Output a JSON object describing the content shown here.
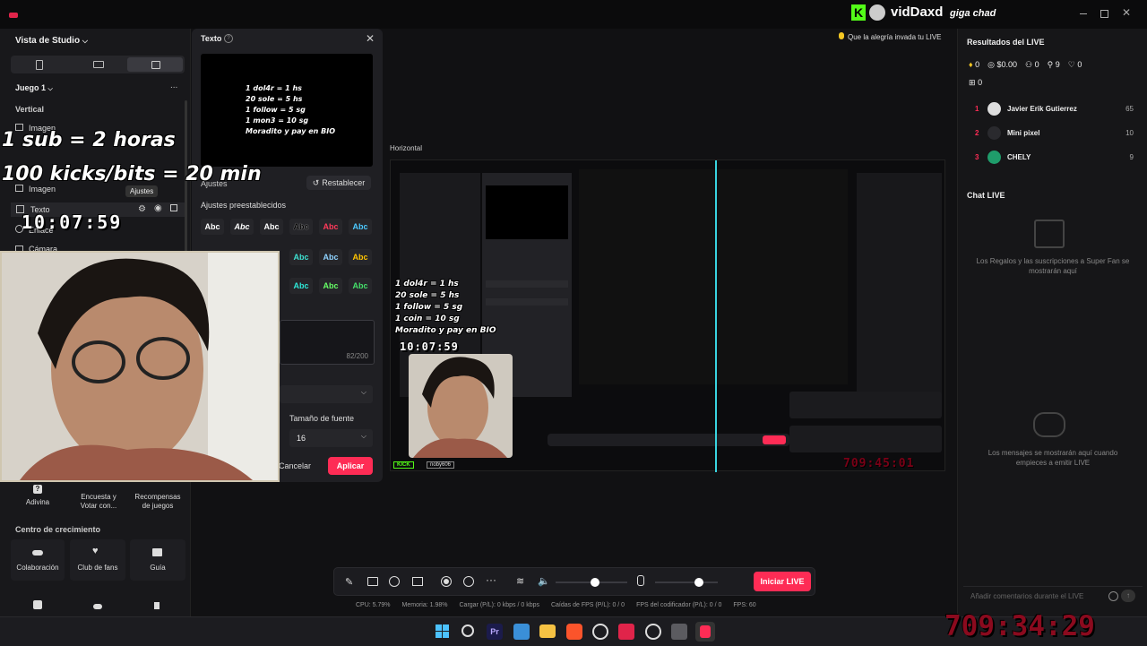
{
  "topbar": {
    "streamer_name": "vidDaxd",
    "nickname": "giga chad"
  },
  "left_panel": {
    "studio_view_label": "Vista de Studio",
    "game_label": "Juego 1",
    "more_label": "...",
    "vertical_label": "Vertical",
    "sources": [
      "Imagen",
      "Imagen",
      "Texto",
      "Enlace",
      "Cámara"
    ],
    "settings_tooltip": "Ajustes",
    "tools": [
      "Adivina",
      "Encuesta y Votar con...",
      "Recompensas de juegos"
    ],
    "growth_center_label": "Centro de crecimiento",
    "growth_items": [
      "Colaboración",
      "Club de fans",
      "Guía"
    ]
  },
  "overlay": {
    "sub_text": "1 sub = 2 horas",
    "kicks_text": "100 kicks/bits = 20 min",
    "clock_small": "10:07:59",
    "countdown": "709:34:29"
  },
  "dialog": {
    "title": "Texto",
    "preview_lines": [
      "1 dol4r = 1 hs",
      "20 sole = 5 hs",
      "1 follow = 5 sg",
      "1 mon3 = 10 sg",
      "Moradito y pay en BIO"
    ],
    "adjust_label": "Ajustes",
    "reset_label": "Restablecer",
    "presets_label": "Ajustes preestablecidos",
    "preset_text": "Abc",
    "char_count": "82/200",
    "font_size_label": "Tamaño de fuente",
    "font_size_value": "16",
    "cancel_label": "Cancelar",
    "apply_label": "Aplicar"
  },
  "stage": {
    "notice": "Que la alegría invada tu LIVE",
    "horizontal_label": "Horizontal",
    "preview_lines": [
      "1 dol4r = 1 hs",
      "20 sole = 5 hs",
      "1 follow = 5 sg",
      "1 coin = 10 sg",
      "Moradito y pay en BIO"
    ],
    "preview_clock": "10:07:59",
    "preview_countdown": "709:45:01",
    "kick_badge": "KICK",
    "user_badge": "noby606"
  },
  "controls": {
    "go_live_label": "Iniciar LIVE",
    "stats": [
      "CPU: 5.79%",
      "Memoria: 1.98%",
      "Cargar (P/L): 0 kbps / 0 kbps",
      "Caídas de FPS (P/L): 0 / 0",
      "FPS del codificador (P/L): 0 / 0",
      "FPS: 60"
    ],
    "volume_level": 0.55,
    "mic_level": 0.7
  },
  "right_panel": {
    "results_title": "Resultados del LIVE",
    "stats": [
      "0",
      "$0.00",
      "0",
      "9",
      "0"
    ],
    "gifts_count": "0",
    "ranking": [
      {
        "rank": "1",
        "name": "Javier Erik Gutierrez",
        "score": "65"
      },
      {
        "rank": "2",
        "name": "Mini pixel",
        "score": "10"
      },
      {
        "rank": "3",
        "name": "CHELY",
        "score": "9"
      }
    ],
    "chat_title": "Chat LIVE",
    "gifts_info": "Los Regalos y las suscripciones a Super Fan se mostrarán aquí",
    "messages_info": "Los mensajes se mostrarán aquí cuando empieces a emitir LIVE",
    "comment_placeholder": "Añadir comentarios durante el LIVE"
  },
  "colors": {
    "accent": "#fe2c55",
    "kick_green": "#53fc18"
  }
}
